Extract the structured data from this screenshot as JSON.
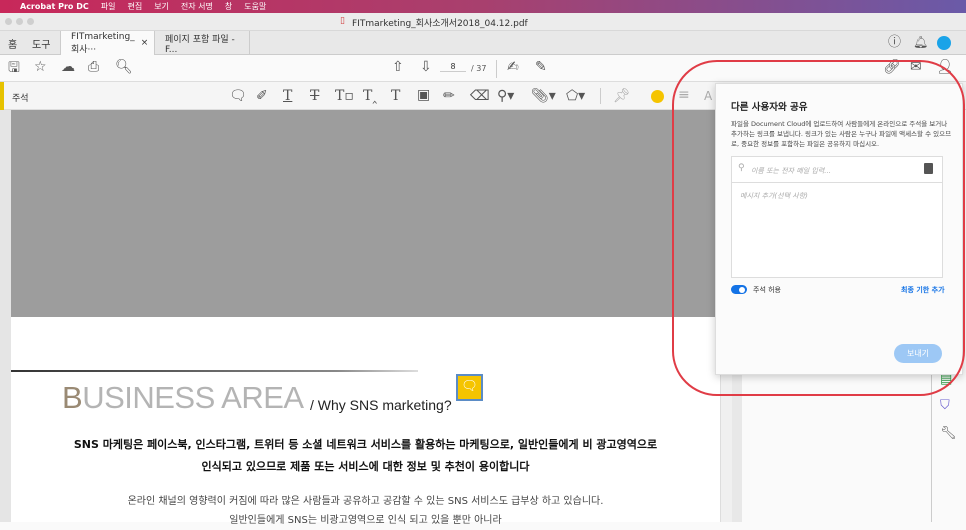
{
  "menubar": {
    "app": "Acrobat Pro DC",
    "items": [
      "파일",
      "편집",
      "보기",
      "전자 서명",
      "창",
      "도움말"
    ]
  },
  "window": {
    "title": "FITmarketing_회사소개서2018_04.12.pdf"
  },
  "tabs": {
    "home": "홈",
    "tools": "도구",
    "doc_tabs": [
      {
        "label": "FITmarketing_회사···",
        "close": "×"
      },
      {
        "label": "페이지 포함 파일 - F..."
      }
    ]
  },
  "toolbar": {
    "page_current": "8",
    "page_total": "/ 37"
  },
  "comment_bar": {
    "label": "주석",
    "font_label": "A"
  },
  "document": {
    "title_initial": "B",
    "title_rest": "USINESS AREA",
    "subtitle": "/ Why SNS marketing?",
    "bold_line1": "SNS 마케팅은 페이스북, 인스타그램, 트위터 등 소셜 네트워크 서비스를 활용하는 마케팅으로, 일반인들에게 비 광고영역으로",
    "bold_line2": "인식되고 있으므로  제품 또는 서비스에 대한 정보 및 추천이 용이합니다",
    "body_line1": "온라인 채널의 영향력이 커짐에 따라 많은 사람들과 공유하고 공감할 수 있는 SNS 서비스도 급부상 하고 있습니다.",
    "body_line2": "일반인들에게 SNS는 비광고영역으로 인식 되고 있을 뿐만 아니라"
  },
  "share_popup": {
    "title": "다른 사용자와 공유",
    "description": "파일을 Document Cloud에 업로드하여 사람들에게 온라인으로 주석을 보거나 추가하는 링크를 보냅니다. 링크가 있는 사람은 누구나 파일에 액세스할 수 있으므로, 중요한 정보를 포함하는 파일은 공유하지 마십시오.",
    "recipient_placeholder": "이름 또는 전자 메일 입력...",
    "message_placeholder": "메시지 추가(선택 사항)",
    "allow_comments_label": "주석 허용",
    "allow_comments": true,
    "add_deadline": "최종 기한 추가",
    "send": "보내기"
  },
  "colors": {
    "accent": "#1473e6",
    "highlight": "#e03c46",
    "note": "#f5c400"
  }
}
